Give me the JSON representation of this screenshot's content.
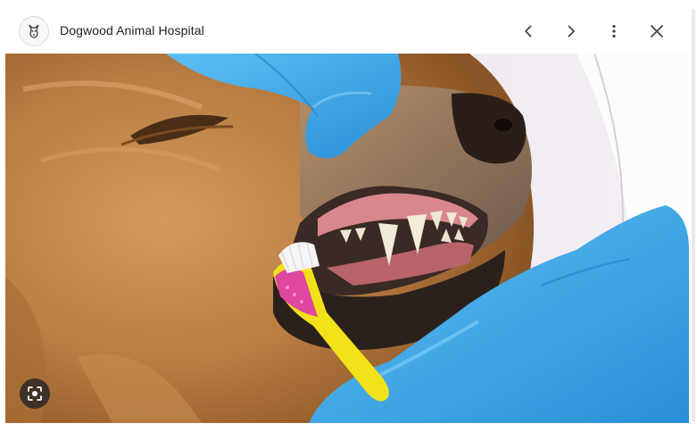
{
  "header": {
    "site_name": "Dogwood Animal Hospital",
    "site_icon": "dog-logo-icon",
    "prev_icon": "chevron-left-icon",
    "next_icon": "chevron-right-icon",
    "more_icon": "more-vert-icon",
    "close_icon": "close-icon"
  },
  "image": {
    "subject": "photo",
    "lens_icon": "lens-search-icon"
  },
  "colors": {
    "glove": "#3ea8e8",
    "toothbrush": "#f2e21a",
    "bristle_head": "#e0479e",
    "fur": "#c08a52"
  }
}
